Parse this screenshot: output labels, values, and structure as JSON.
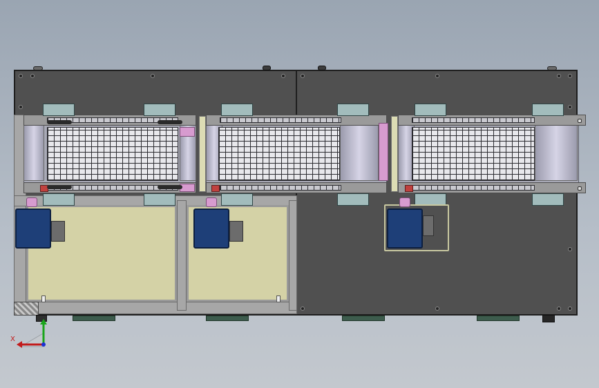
{
  "triad": {
    "x_label": "X"
  },
  "colors": {
    "plate": "#505050",
    "cabinet_panel": "#d4d2a6",
    "motor": "#1e3f78",
    "bracket": "#a2bcbc",
    "belt": "#a9aab7",
    "axis_x": "#c21b1b",
    "axis_y": "#1aa51a",
    "axis_z": "#1b2fd4"
  },
  "conveyors": [
    {
      "id": "conveyor-1"
    },
    {
      "id": "conveyor-2"
    },
    {
      "id": "conveyor-3"
    }
  ]
}
